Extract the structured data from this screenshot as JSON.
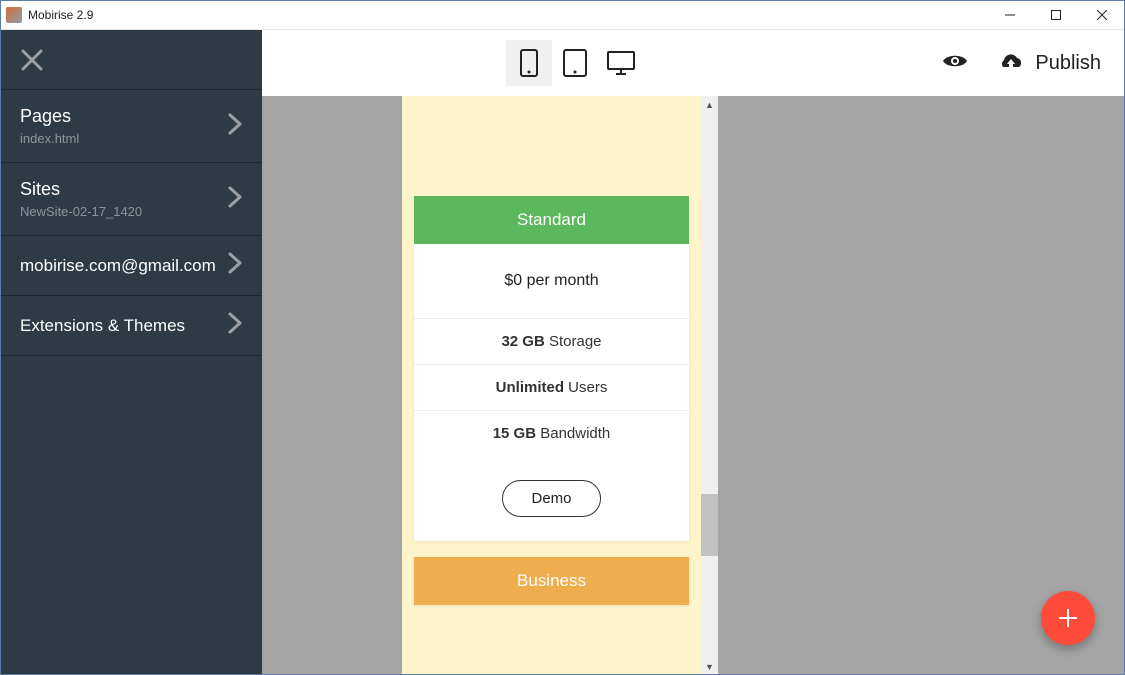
{
  "window": {
    "title": "Mobirise 2.9"
  },
  "sidebar": {
    "pages": {
      "title": "Pages",
      "sub": "index.html"
    },
    "sites": {
      "title": "Sites",
      "sub": "NewSite-02-17_1420"
    },
    "account": {
      "title": "mobirise.com@gmail.com"
    },
    "extensions": {
      "title": "Extensions & Themes"
    }
  },
  "topbar": {
    "publish": "Publish"
  },
  "pricing": {
    "standard": {
      "name": "Standard",
      "price": "$0 per month",
      "f1b": "32 GB",
      "f1": " Storage",
      "f2b": "Unlimited",
      "f2": " Users",
      "f3b": "15 GB",
      "f3": " Bandwidth",
      "cta": "Demo"
    },
    "business": {
      "name": "Business"
    }
  }
}
